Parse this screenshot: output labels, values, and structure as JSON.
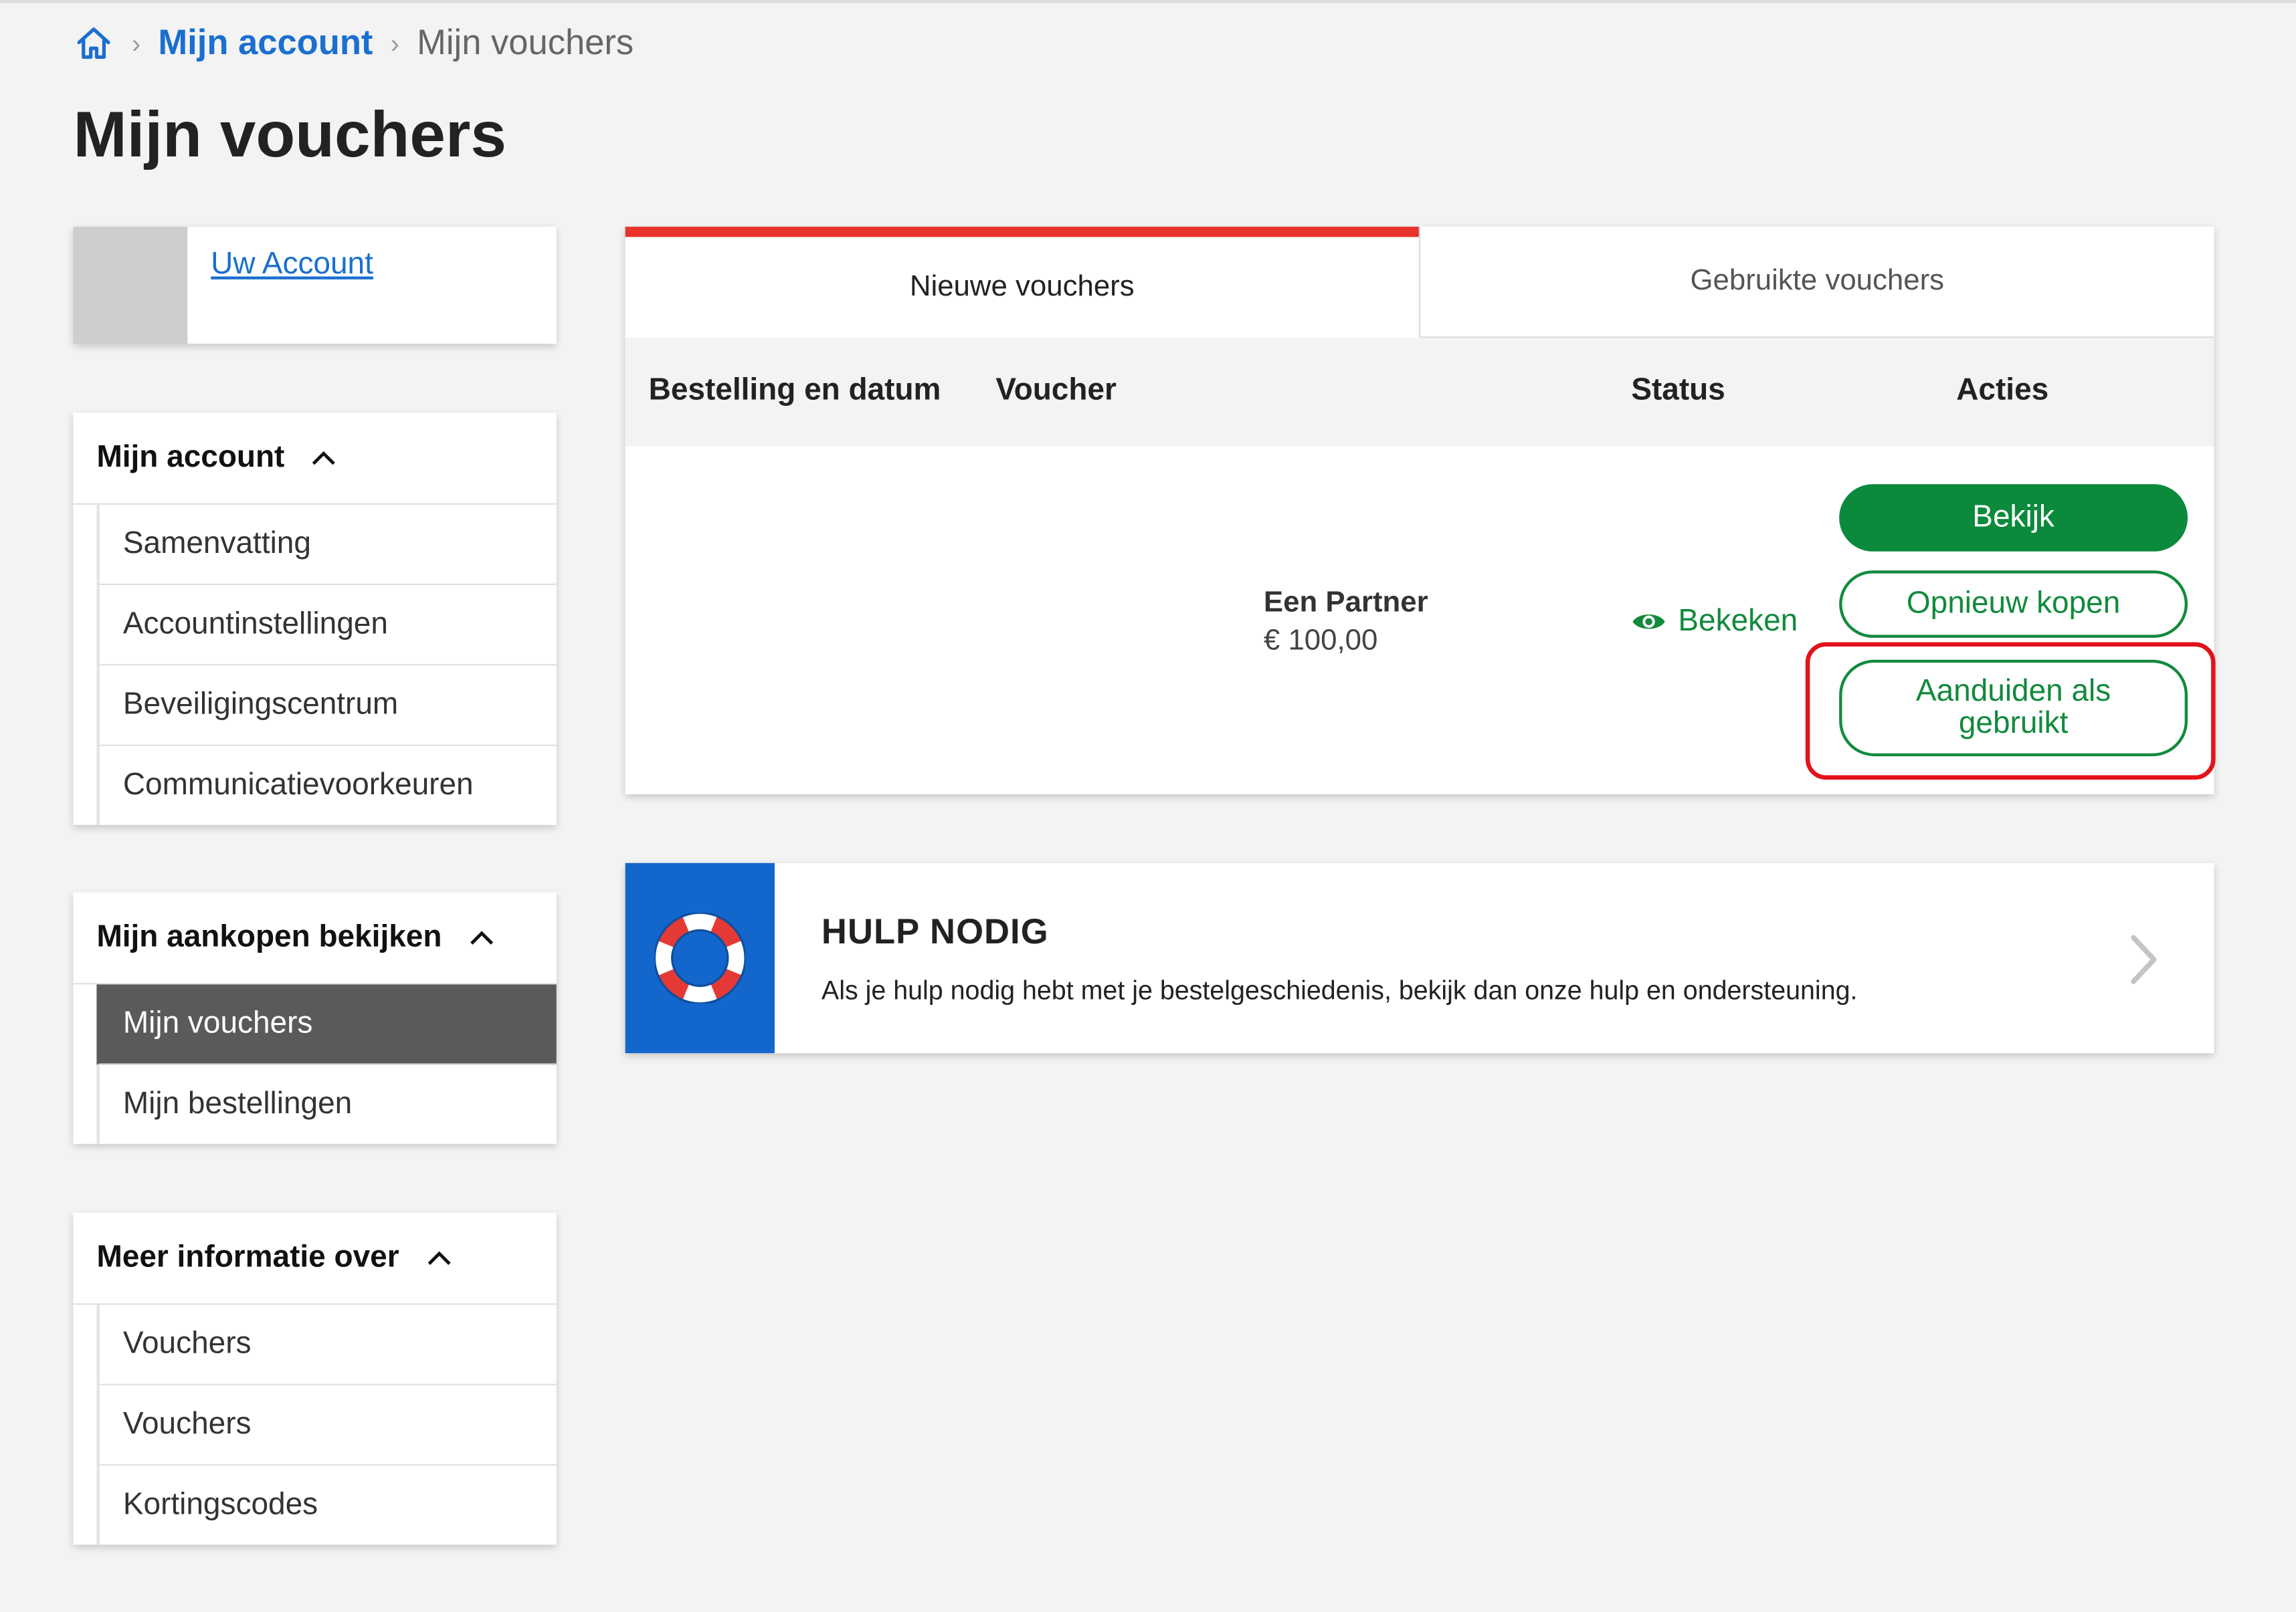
{
  "breadcrumb": {
    "home_icon": "home-icon",
    "account": "Mijn account",
    "current": "Mijn vouchers"
  },
  "page_title": "Mijn vouchers",
  "sidebar": {
    "account_link": "Uw Account",
    "menus": [
      {
        "title": "Mijn account",
        "items": [
          "Samenvatting",
          "Accountinstellingen",
          "Beveiligingscentrum",
          "Communicatievoorkeuren"
        ]
      },
      {
        "title": "Mijn aankopen bekijken",
        "items": [
          "Mijn vouchers",
          "Mijn bestellingen"
        ],
        "active": "Mijn vouchers"
      },
      {
        "title": "Meer informatie over",
        "items": [
          "Vouchers",
          "Vouchers",
          "Kortingscodes"
        ]
      }
    ]
  },
  "tabs": {
    "new": "Nieuwe vouchers",
    "used": "Gebruikte vouchers"
  },
  "table": {
    "headers": {
      "order_date": "Bestelling en datum",
      "voucher": "Voucher",
      "status": "Status",
      "actions": "Acties"
    },
    "row": {
      "voucher_name": "Een Partner",
      "voucher_price": "€ 100,00",
      "status": "Bekeken",
      "actions": {
        "view": "Bekijk",
        "rebuy": "Opnieuw kopen",
        "mark_used": "Aanduiden als gebruikt"
      }
    }
  },
  "help": {
    "title": "HULP NODIG",
    "text": "Als je hulp nodig hebt met je bestelgeschiedenis, bekijk dan onze hulp en ondersteuning."
  },
  "colors": {
    "accent_red": "#e8322a",
    "primary_green": "#0b8a3c",
    "link_blue": "#1a6fcf",
    "help_blue": "#1366cc",
    "highlight": "#e3131b"
  }
}
